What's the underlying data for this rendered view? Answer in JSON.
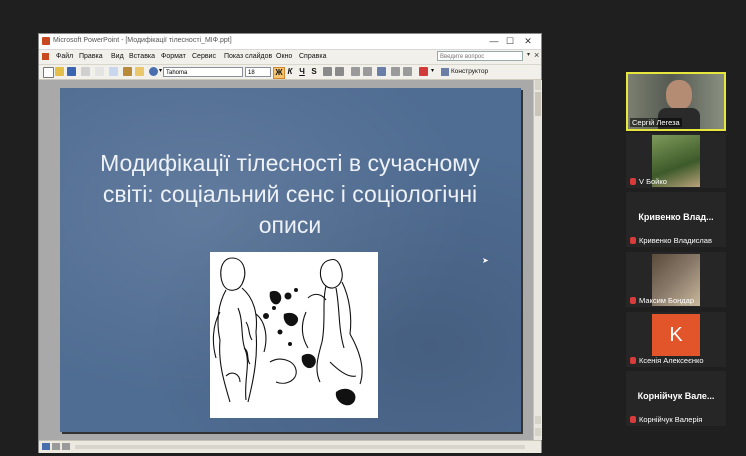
{
  "window": {
    "title": "Microsoft PowerPoint - [Модифікації тілесності_МІФ.ppt]",
    "minimize": "—",
    "maximize": "☐",
    "close": "✕"
  },
  "menu": {
    "items": [
      "Файл",
      "Правка",
      "Вид",
      "Вставка",
      "Формат",
      "Сервис",
      "Показ слайдов",
      "Окно",
      "Справка"
    ],
    "help_placeholder": "Введите вопрос",
    "close_doc": "×"
  },
  "toolbar": {
    "font_name": "Tahoma",
    "font_size": "18",
    "bold": "Ж",
    "italic": "К",
    "underline": "Ч",
    "shadow": "S",
    "designer": "Конструктор"
  },
  "slide": {
    "title": "Модифікації тілесності в сучасному світі: соціальний сенс і соціологічні описи"
  },
  "participants": [
    {
      "name": "Сергій Легеза",
      "kind": "video-active"
    },
    {
      "name": "V Бойко",
      "kind": "video"
    },
    {
      "name": "Кривенко Владислав",
      "display": "Кривенко Влад...",
      "kind": "text"
    },
    {
      "name": "Максим Бондар",
      "kind": "video"
    },
    {
      "name": "Ксенія Алексеєнко",
      "initial": "K",
      "kind": "avatar"
    },
    {
      "name": "Корнійчук Валерія",
      "display": "Корнійчук Вале...",
      "kind": "text"
    }
  ],
  "colors": {
    "slide_bg": "#4f6c92",
    "active_border": "#e6e63c",
    "avatar_bg": "#e2542a",
    "mic_muted": "#d93a3a"
  }
}
